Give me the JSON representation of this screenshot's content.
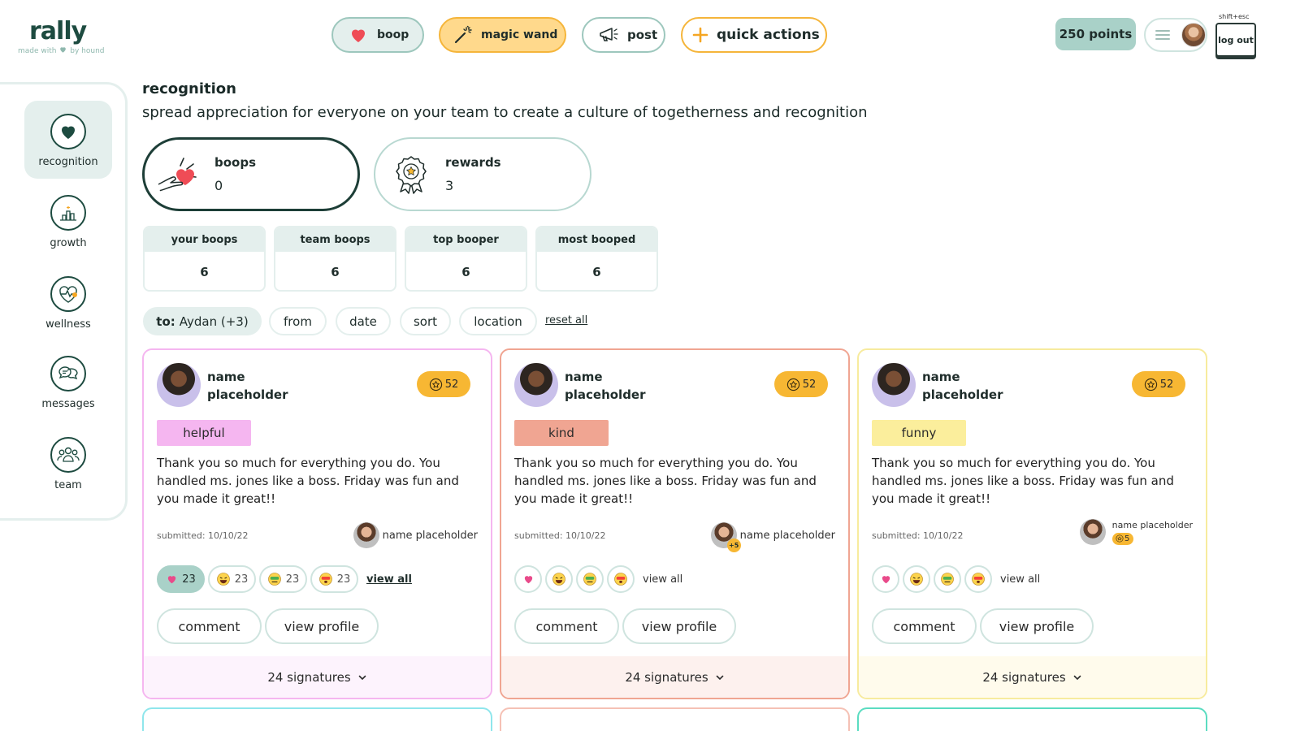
{
  "brand": {
    "name": "rally",
    "tagline_pre": "made with",
    "tagline_post": "by hound"
  },
  "header": {
    "buttons": {
      "boop": "boop",
      "magic_wand": "magic wand",
      "post": "post",
      "quick_actions": "quick actions"
    },
    "points": "250 points",
    "shortcut": "shift+esc",
    "logout": "log out"
  },
  "sidebar": {
    "items": [
      {
        "label": "recognition",
        "icon": "heart-icon",
        "active": true
      },
      {
        "label": "growth",
        "icon": "chart-icon"
      },
      {
        "label": "wellness",
        "icon": "heartbeat-icon"
      },
      {
        "label": "messages",
        "icon": "chat-icon"
      },
      {
        "label": "team",
        "icon": "team-icon"
      }
    ]
  },
  "page": {
    "title": "recognition",
    "subtitle": "spread appreciation for everyone on your team to create a culture of togetherness and recognition"
  },
  "stats": {
    "boops": {
      "label": "boops",
      "value": "0"
    },
    "rewards": {
      "label": "rewards",
      "value": "3"
    }
  },
  "mini_stats": [
    {
      "label": "your boops",
      "value": "6"
    },
    {
      "label": "team boops",
      "value": "6"
    },
    {
      "label": "top booper",
      "value": "6"
    },
    {
      "label": "most booped",
      "value": "6"
    }
  ],
  "filters": {
    "to_prefix": "to:",
    "to_value": "Aydan (+3)",
    "from": "from",
    "date": "date",
    "sort": "sort",
    "location": "location",
    "reset": "reset all"
  },
  "cards": [
    {
      "name": "name placeholder",
      "badge": "52",
      "tag": "helpful",
      "message": "Thank you so much for everything you do. You handled ms. jones like a boss. Friday was fun and you made it great!!",
      "submitted": "submitted: 10/10/22",
      "from_name": "name placeholder",
      "reactions": [
        "23",
        "23",
        "23",
        "23"
      ],
      "view_all": "view all",
      "comment": "comment",
      "view_profile": "view profile",
      "signatures": "24 signatures"
    },
    {
      "name": "name placeholder",
      "badge": "52",
      "tag": "kind",
      "message": "Thank you so much for everything you do. You handled ms. jones like a boss. Friday was fun and you made it great!!",
      "submitted": "submitted: 10/10/22",
      "from_name": "name placeholder",
      "from_extra": "+5",
      "view_all": "view all",
      "comment": "comment",
      "view_profile": "view profile",
      "signatures": "24 signatures"
    },
    {
      "name": "name placeholder",
      "badge": "52",
      "tag": "funny",
      "message": "Thank you so much for everything you do. You handled ms. jones like a boss. Friday was fun and you made it great!!",
      "submitted": "submitted: 10/10/22",
      "from_name": "name placeholder",
      "from_points": "5",
      "view_all": "view all",
      "comment": "comment",
      "view_profile": "view profile",
      "signatures": "24 signatures"
    }
  ],
  "colors": {
    "brand": "#1d4b40",
    "mint": "#e4efed",
    "accent_orange": "#f7b733",
    "tag_helpful": "#f5b6f0",
    "tag_kind": "#f0a592",
    "tag_funny": "#fbee9c"
  }
}
